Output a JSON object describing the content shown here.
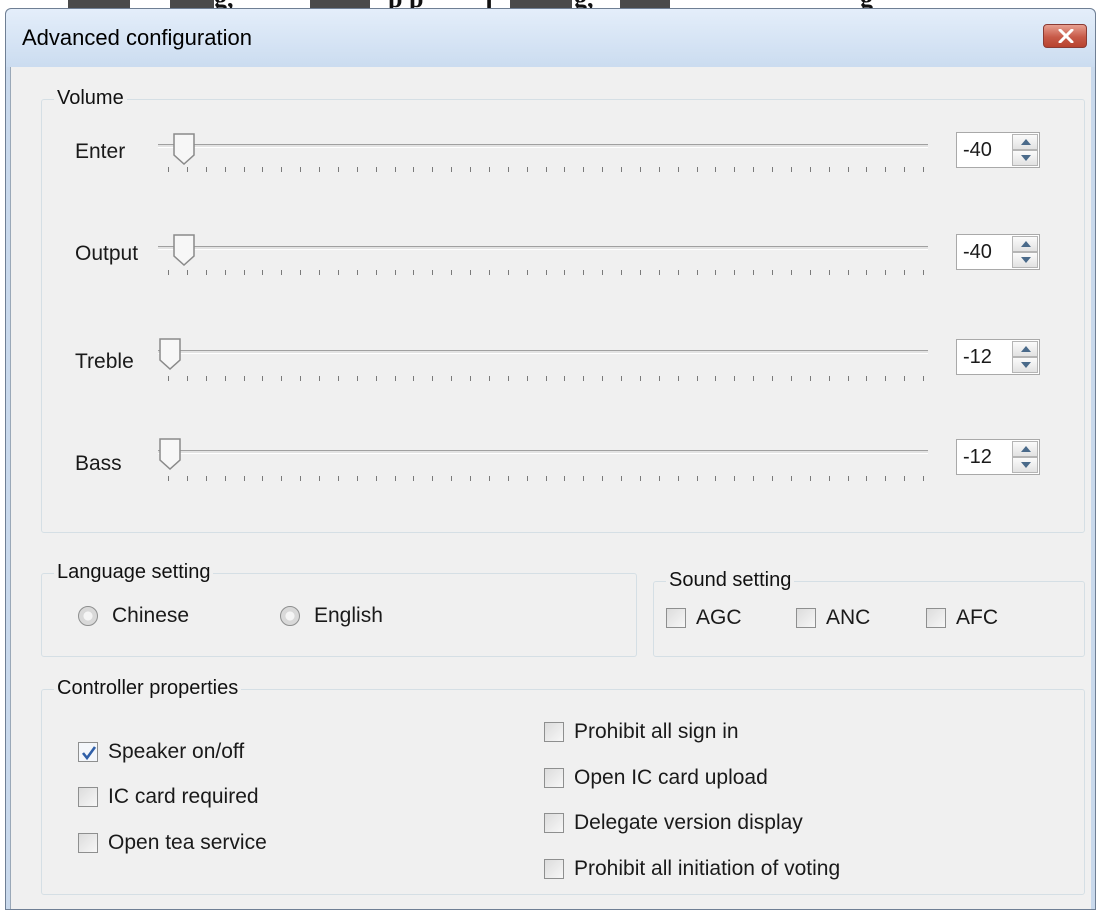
{
  "window": {
    "title": "Advanced configuration",
    "close_icon": "close-icon"
  },
  "background_text": [
    "g,",
    "p p",
    "j",
    "g,",
    "g"
  ],
  "volume": {
    "label": "Volume",
    "sliders": [
      {
        "label": "Enter",
        "value": "-40",
        "position": 0.02
      },
      {
        "label": "Output",
        "value": "-40",
        "position": 0.02
      },
      {
        "label": "Treble",
        "value": "-12",
        "position": 0.0
      },
      {
        "label": "Bass",
        "value": "-12",
        "position": 0.0
      }
    ]
  },
  "language": {
    "label": "Language setting",
    "options": [
      {
        "label": "Chinese",
        "selected": false
      },
      {
        "label": "English",
        "selected": false
      }
    ]
  },
  "sound": {
    "label": "Sound setting",
    "options": [
      {
        "label": "AGC",
        "checked": false
      },
      {
        "label": "ANC",
        "checked": false
      },
      {
        "label": "AFC",
        "checked": false
      }
    ]
  },
  "controller": {
    "label": "Controller properties",
    "left": [
      {
        "label": "Speaker on/off",
        "checked": true
      },
      {
        "label": "IC card required",
        "checked": false
      },
      {
        "label": "Open tea service",
        "checked": false
      }
    ],
    "right": [
      {
        "label": "Prohibit all sign in",
        "checked": false
      },
      {
        "label": "Open IC card upload",
        "checked": false
      },
      {
        "label": "Delegate version display",
        "checked": false
      },
      {
        "label": "Prohibit all initiation of voting",
        "checked": false
      }
    ]
  },
  "colors": {
    "title_bar": "#cbdcf0",
    "close_button": "#c75a48",
    "check_mark": "#2f5fa8"
  }
}
